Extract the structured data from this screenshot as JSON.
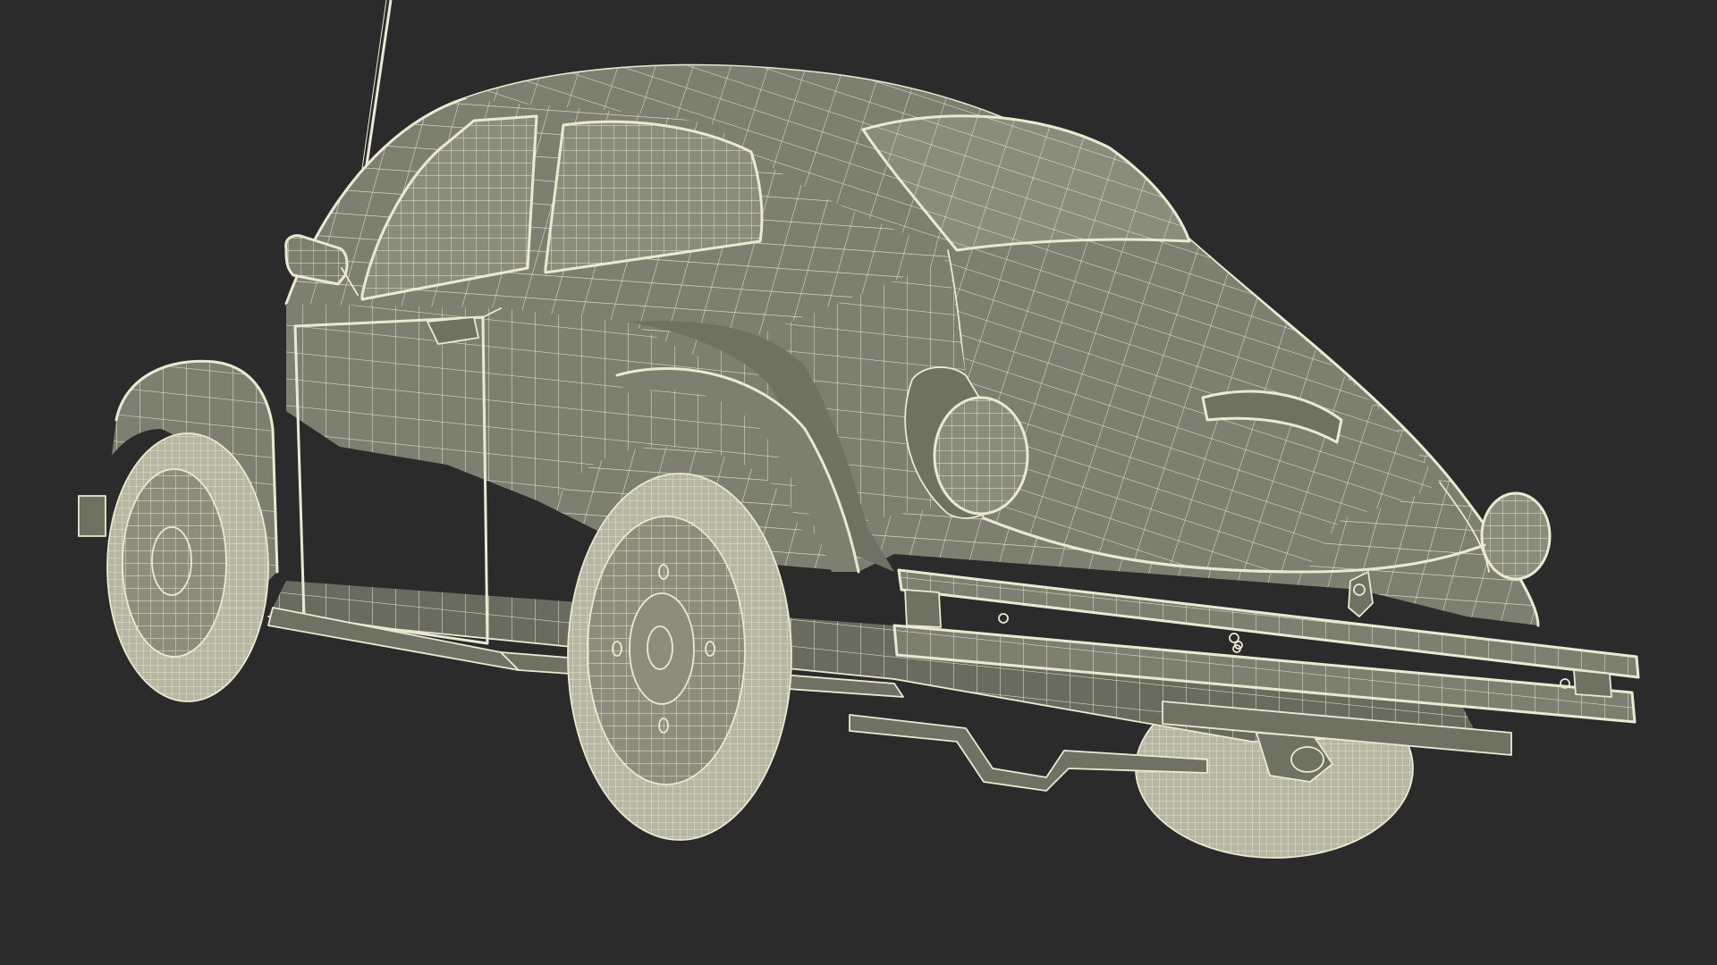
{
  "scene": {
    "subject": "car-wireframe",
    "background_color": "#2b2b2b",
    "wire_color": "#ece9d2",
    "body_color": "#7d7f70",
    "tire_color": "#b6b6a2"
  }
}
